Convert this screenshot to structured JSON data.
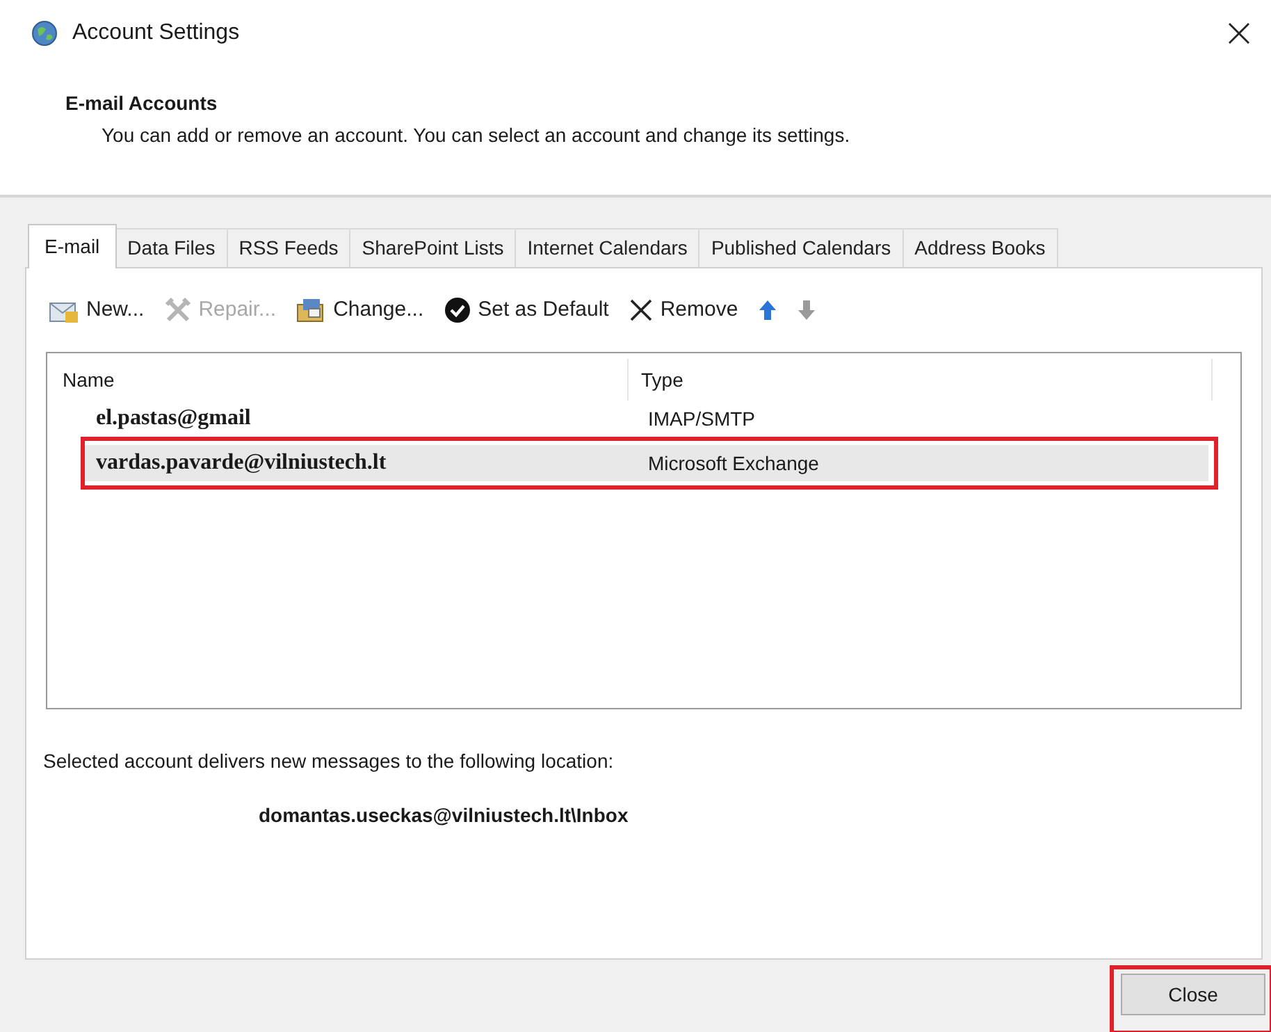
{
  "window": {
    "title": "Account Settings"
  },
  "header": {
    "title": "E-mail Accounts",
    "description": "You can add or remove an account. You can select an account and change its settings."
  },
  "tabs": [
    {
      "label": "E-mail",
      "selected": true
    },
    {
      "label": "Data Files",
      "selected": false
    },
    {
      "label": "RSS Feeds",
      "selected": false
    },
    {
      "label": "SharePoint Lists",
      "selected": false
    },
    {
      "label": "Internet Calendars",
      "selected": false
    },
    {
      "label": "Published Calendars",
      "selected": false
    },
    {
      "label": "Address Books",
      "selected": false
    }
  ],
  "toolbar": [
    {
      "kind": "new",
      "label": "New...",
      "disabled": false
    },
    {
      "kind": "repair",
      "label": "Repair...",
      "disabled": true
    },
    {
      "kind": "change",
      "label": "Change...",
      "disabled": false
    },
    {
      "kind": "default",
      "label": "Set as Default",
      "disabled": false
    },
    {
      "kind": "remove",
      "label": "Remove",
      "disabled": false
    },
    {
      "kind": "up",
      "disabled": false
    },
    {
      "kind": "down",
      "disabled": true
    }
  ],
  "table": {
    "columns": [
      "Name",
      "Type"
    ],
    "rows": [
      {
        "name": "el.pastas@gmail",
        "type": "IMAP/SMTP",
        "selected": false,
        "highlighted": false
      },
      {
        "name": "vardas.pavarde@vilniustech.lt",
        "type": "Microsoft Exchange",
        "selected": true,
        "highlighted": true
      }
    ]
  },
  "delivery": {
    "label": "Selected account delivers new messages to the following location:",
    "location": "domantas.useckas@vilniustech.lt\\Inbox"
  },
  "close_button": {
    "label": "Close",
    "highlighted": true
  }
}
